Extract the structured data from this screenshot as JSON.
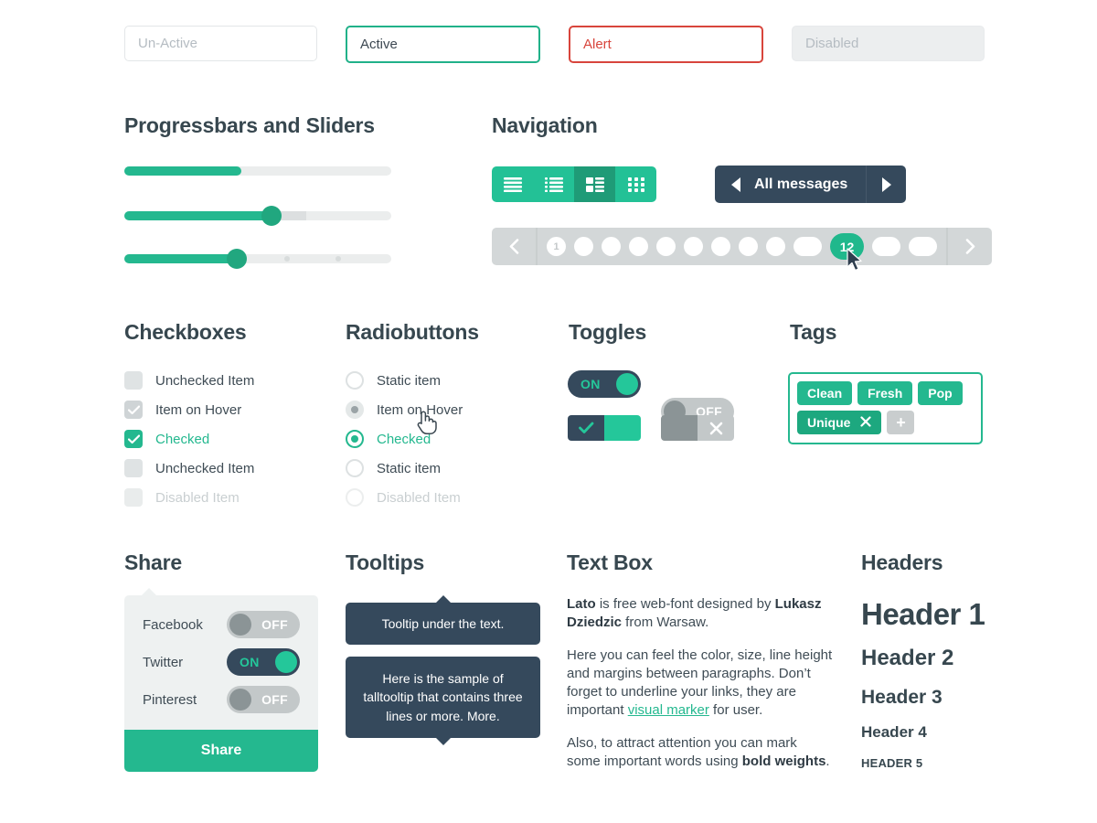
{
  "inputs": [
    {
      "name": "un-active",
      "value": "Un-Active",
      "state": "placeholder"
    },
    {
      "name": "active",
      "value": "Active",
      "state": "focused"
    },
    {
      "name": "alert",
      "value": "Alert",
      "state": "error"
    },
    {
      "name": "disabled",
      "value": "Disabled",
      "state": "disabled"
    }
  ],
  "progress": {
    "title": "Progressbars and Sliders",
    "bars": [
      {
        "name": "progressbar",
        "value": 44
      },
      {
        "name": "slider-with-buffer",
        "value": 55,
        "buffer": 68
      },
      {
        "name": "slider-with-steps",
        "value": 42,
        "ticks": [
          60,
          79
        ]
      }
    ]
  },
  "navigation": {
    "title": "Navigation",
    "view_buttons": [
      {
        "icon": "list-justify-icon",
        "active": false
      },
      {
        "icon": "list-bullet-icon",
        "active": false
      },
      {
        "icon": "list-grid-icon",
        "active": true
      },
      {
        "icon": "grid-icon",
        "active": false
      }
    ],
    "messages_button": {
      "label": "All messages",
      "prev_icon": "triangle-left-icon",
      "next_icon": "triangle-right-icon"
    },
    "pagination": {
      "prev_icon": "chevron-left-icon",
      "next_icon": "chevron-right-icon",
      "pages": [
        "1",
        "",
        "",
        "",
        "",
        "",
        "",
        "",
        "",
        "",
        "12",
        "",
        ""
      ],
      "current": "12"
    }
  },
  "checkboxes": {
    "title": "Checkboxes",
    "items": [
      {
        "label": "Unchecked Item",
        "state": "unchecked"
      },
      {
        "label": "Item on Hover",
        "state": "hover"
      },
      {
        "label": "Checked",
        "state": "checked"
      },
      {
        "label": "Unchecked Item",
        "state": "unchecked"
      },
      {
        "label": "Disabled Item",
        "state": "disabled"
      }
    ]
  },
  "radiobuttons": {
    "title": "Radiobuttons",
    "items": [
      {
        "label": "Static item",
        "state": "unchecked"
      },
      {
        "label": "Item on Hover",
        "state": "hover"
      },
      {
        "label": "Checked",
        "state": "checked"
      },
      {
        "label": "Static item",
        "state": "unchecked"
      },
      {
        "label": "Disabled Item",
        "state": "disabled"
      }
    ]
  },
  "toggles": {
    "title": "Toggles",
    "on_label": "ON",
    "off_label": "OFF",
    "check_icon": "check-icon",
    "cross_icon": "cross-icon"
  },
  "tags": {
    "title": "Tags",
    "items": [
      {
        "label": "Clean",
        "removable": false,
        "hover": false
      },
      {
        "label": "Fresh",
        "removable": false,
        "hover": false
      },
      {
        "label": "Pop",
        "removable": false,
        "hover": false
      },
      {
        "label": "Unique",
        "removable": true,
        "hover": true
      }
    ],
    "remove_icon": "close-icon",
    "add_label": "+"
  },
  "share": {
    "title": "Share",
    "rows": [
      {
        "name": "Facebook",
        "state": "OFF"
      },
      {
        "name": "Twitter",
        "state": "ON"
      },
      {
        "name": "Pinterest",
        "state": "OFF"
      }
    ],
    "button_label": "Share"
  },
  "tooltips": {
    "title": "Tooltips",
    "short": "Tooltip under the text.",
    "tall": "Here is the sample of talltooltip that contains three lines or more. More."
  },
  "textbox": {
    "title": "Text Box",
    "p1_bold1": "Lato",
    "p1_mid": " is free web-font designed by  ",
    "p1_bold2": "Lukasz Dziedzic",
    "p1_end": " from Warsaw.",
    "p2_start": "Here you can feel the color, size, line height and margins between paragraphs. Don’t forget to underline your links, they are important ",
    "p2_link": "visual marker",
    "p2_end": " for user.",
    "p3_start": "Also, to attract attention you can mark some important words using ",
    "p3_bold": "bold weights",
    "p3_end": "."
  },
  "headers": {
    "title": "Headers",
    "h1": "Header 1",
    "h2": "Header 2",
    "h3": "Header 3",
    "h4": "Header 4",
    "h5": "HEADER 5"
  },
  "colors": {
    "accent": "#24b88f",
    "dark": "#35495c",
    "alert": "#d8453c",
    "gray": "#c3c8c9"
  }
}
